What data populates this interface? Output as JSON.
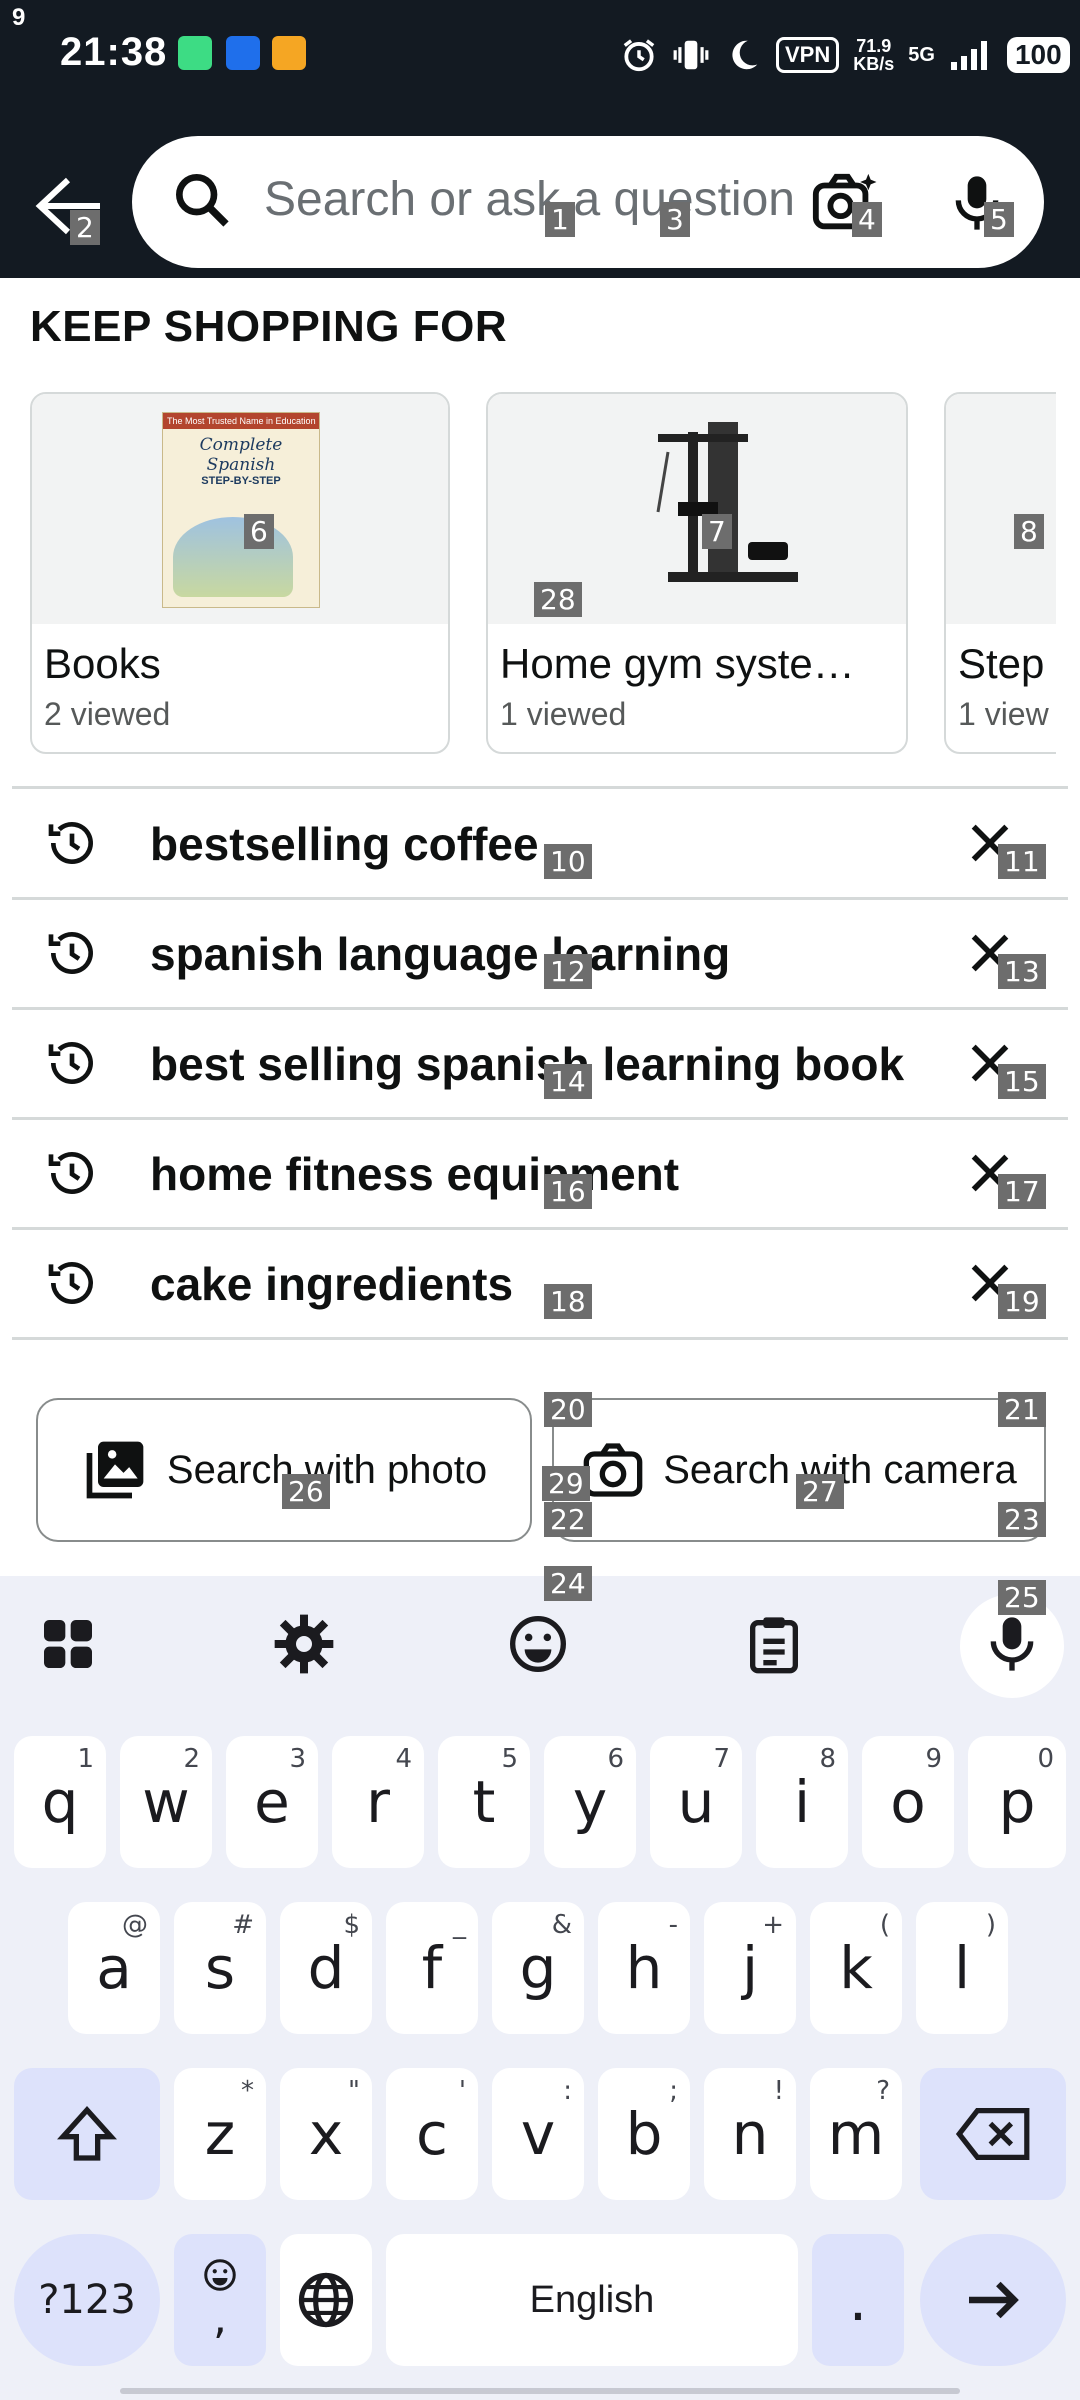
{
  "status_bar": {
    "notification_count": "9",
    "time": "21:38",
    "network_speed_top": "71.9",
    "network_speed_bottom": "KB/s",
    "vpn_label": "VPN",
    "signal_label": "5G",
    "battery": "100"
  },
  "header": {
    "search_placeholder": "Search or ask a question"
  },
  "keep_shopping": {
    "title": "KEEP SHOPPING FOR",
    "cards": [
      {
        "title": "Books",
        "subtitle": "2 viewed",
        "book_cover_top": "The Most Trusted Name in Education",
        "book_cover_title": "Complete Spanish",
        "book_cover_sub": "STEP-BY-STEP"
      },
      {
        "title": "Home gym syste…",
        "subtitle": "1 viewed"
      },
      {
        "title": "Step",
        "subtitle": "1 view"
      }
    ]
  },
  "history": [
    {
      "query": "bestselling coffee"
    },
    {
      "query": "spanish language learning"
    },
    {
      "query": "best selling spanish learning book"
    },
    {
      "query": "home fitness equipment"
    },
    {
      "query": "cake ingredients"
    }
  ],
  "search_buttons": {
    "photo": "Search with photo",
    "camera": "Search with camera"
  },
  "keyboard": {
    "row1": [
      [
        "q",
        "1"
      ],
      [
        "w",
        "2"
      ],
      [
        "e",
        "3"
      ],
      [
        "r",
        "4"
      ],
      [
        "t",
        "5"
      ],
      [
        "y",
        "6"
      ],
      [
        "u",
        "7"
      ],
      [
        "i",
        "8"
      ],
      [
        "o",
        "9"
      ],
      [
        "p",
        "0"
      ]
    ],
    "row2": [
      [
        "a",
        "@"
      ],
      [
        "s",
        "#"
      ],
      [
        "d",
        "$"
      ],
      [
        "f",
        "_"
      ],
      [
        "g",
        "&"
      ],
      [
        "h",
        "-"
      ],
      [
        "j",
        "+"
      ],
      [
        "k",
        "("
      ],
      [
        "l",
        ")"
      ]
    ],
    "row3": [
      [
        "z",
        "*"
      ],
      [
        "x",
        "\""
      ],
      [
        "c",
        "'"
      ],
      [
        "v",
        ":"
      ],
      [
        "b",
        ";"
      ],
      [
        "n",
        "!"
      ],
      [
        "m",
        "?"
      ]
    ],
    "symbols_key": "?123",
    "comma_key": ",",
    "space_label": "English",
    "period_key": "."
  },
  "overlay_labels": [
    "1",
    "2",
    "3",
    "4",
    "5",
    "6",
    "7",
    "8",
    "10",
    "11",
    "12",
    "13",
    "14",
    "15",
    "16",
    "17",
    "18",
    "19",
    "20",
    "21",
    "22",
    "23",
    "24",
    "25",
    "26",
    "27",
    "28",
    "29"
  ],
  "colors": {
    "header_bg": "#131a22",
    "keyboard_bg": "#eef0f8",
    "special_key": "#dde2fb"
  }
}
